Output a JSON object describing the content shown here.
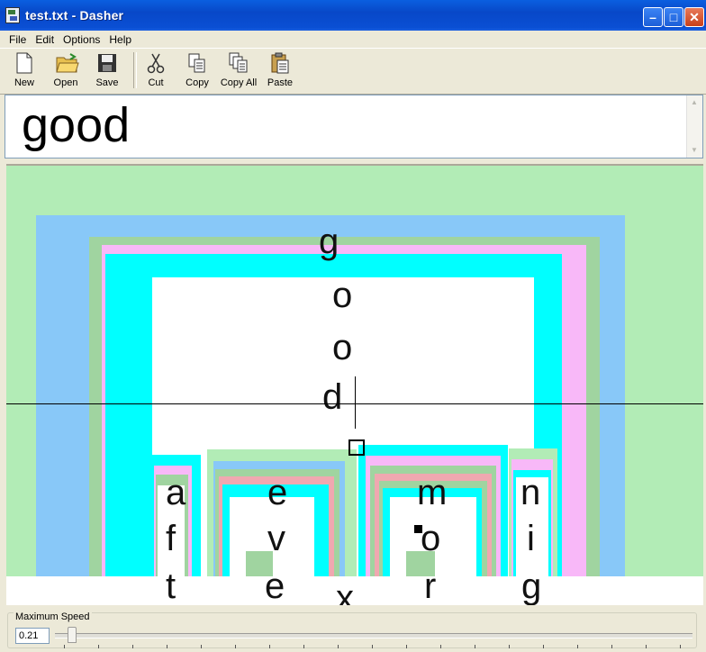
{
  "window": {
    "title": "test.txt - Dasher",
    "minimize_icon": "minimize-icon",
    "maximize_icon": "maximize-icon",
    "close_icon": "close-icon"
  },
  "menu": [
    "File",
    "Edit",
    "Options",
    "Help"
  ],
  "toolbar": {
    "new_label": "New",
    "open_label": "Open",
    "save_label": "Save",
    "cut_label": "Cut",
    "copy_label": "Copy",
    "copyall_label": "Copy All",
    "paste_label": "Paste"
  },
  "editor": {
    "text": "good"
  },
  "canvas": {
    "path_letters": [
      "g",
      "o",
      "o",
      "d"
    ],
    "columns": [
      {
        "top": "a",
        "mid": "f",
        "bot": "t"
      },
      {
        "top": "e",
        "mid": "v",
        "bot": "e"
      },
      {
        "top": "",
        "mid": "",
        "bot": "x"
      },
      {
        "top": "m",
        "mid": "o",
        "bot": "r"
      },
      {
        "top": "n",
        "mid": "i",
        "bot": "g"
      }
    ],
    "colors": {
      "green": "#b2ecb6",
      "blue": "#88c8f8",
      "pink": "#f8b8f8",
      "cyan": "#00ffff",
      "sage": "#a0d4a0",
      "rose": "#f0a8b0",
      "white": "#ffffff"
    }
  },
  "speed": {
    "label": "Maximum Speed",
    "value": "0.21",
    "fraction": 0.02
  }
}
